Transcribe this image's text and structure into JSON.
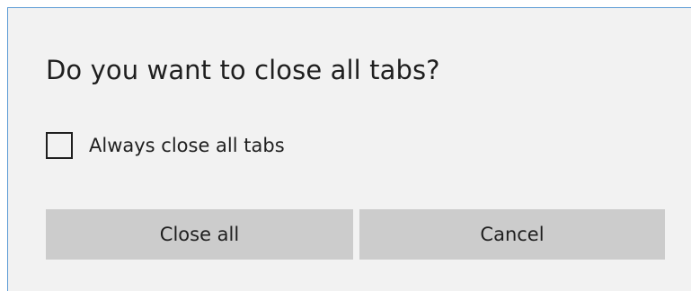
{
  "dialog": {
    "title": "Do you want to close all tabs?",
    "checkbox": {
      "label": "Always close all tabs",
      "checked": false
    },
    "buttons": {
      "close_all": "Close all",
      "cancel": "Cancel"
    }
  },
  "colors": {
    "dialog_background": "#f2f2f2",
    "accent_border": "#5b9bd5",
    "button_background": "#cccccc",
    "text": "#1f1f1f"
  }
}
